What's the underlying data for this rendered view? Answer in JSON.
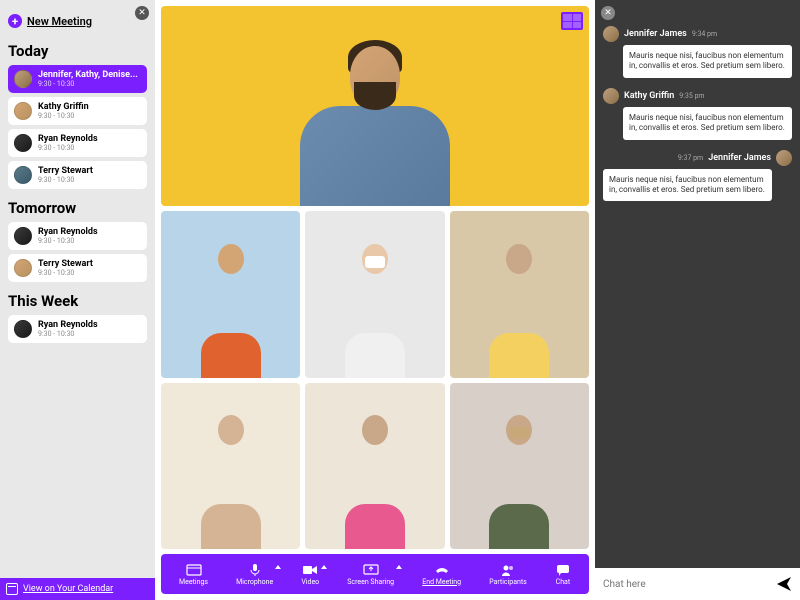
{
  "sidebar": {
    "new_meeting_label": "New Meeting",
    "sections": {
      "today": {
        "title": "Today",
        "items": [
          {
            "name": "Jennifer, Kathy, Denise...",
            "time": "9:30 - 10:30",
            "active": true
          },
          {
            "name": "Kathy Griffin",
            "time": "9:30 - 10:30"
          },
          {
            "name": "Ryan Reynolds",
            "time": "9:30 - 10:30"
          },
          {
            "name": "Terry Stewart",
            "time": "9:30 - 10:30"
          }
        ]
      },
      "tomorrow": {
        "title": "Tomorrow",
        "items": [
          {
            "name": "Ryan Reynolds",
            "time": "9:30 - 10:30"
          },
          {
            "name": "Terry Stewart",
            "time": "9:30 - 10:30"
          }
        ]
      },
      "this_week": {
        "title": "This Week",
        "items": [
          {
            "name": "Ryan Reynolds",
            "time": "9:30 - 10:30"
          }
        ]
      }
    },
    "calendar_link": "View on Your Calendar"
  },
  "toolbar": {
    "meetings": "Meetings",
    "microphone": "Microphone",
    "video": "Video",
    "screen_sharing": "Screen Sharing",
    "end_meeting": "End Meeting",
    "participants": "Participants",
    "chat": "Chat"
  },
  "chat": {
    "messages": [
      {
        "name": "Jennifer James",
        "time": "9:34 pm",
        "text": "Mauris neque nisi, faucibus non elementum in, convallis et eros. Sed pretium sem libero.",
        "side": "left"
      },
      {
        "name": "Kathy Griffin",
        "time": "9:35 pm",
        "text": "Mauris neque nisi, faucibus non elementum in, convallis et eros. Sed pretium sem libero.",
        "side": "left"
      },
      {
        "name": "Jennifer James",
        "time": "9:37 pm",
        "text": "Mauris neque nisi, faucibus non elementum in, convallis et eros. Sed pretium sem libero.",
        "side": "right"
      }
    ],
    "placeholder": "Chat here"
  },
  "colors": {
    "accent": "#7b1fff"
  }
}
